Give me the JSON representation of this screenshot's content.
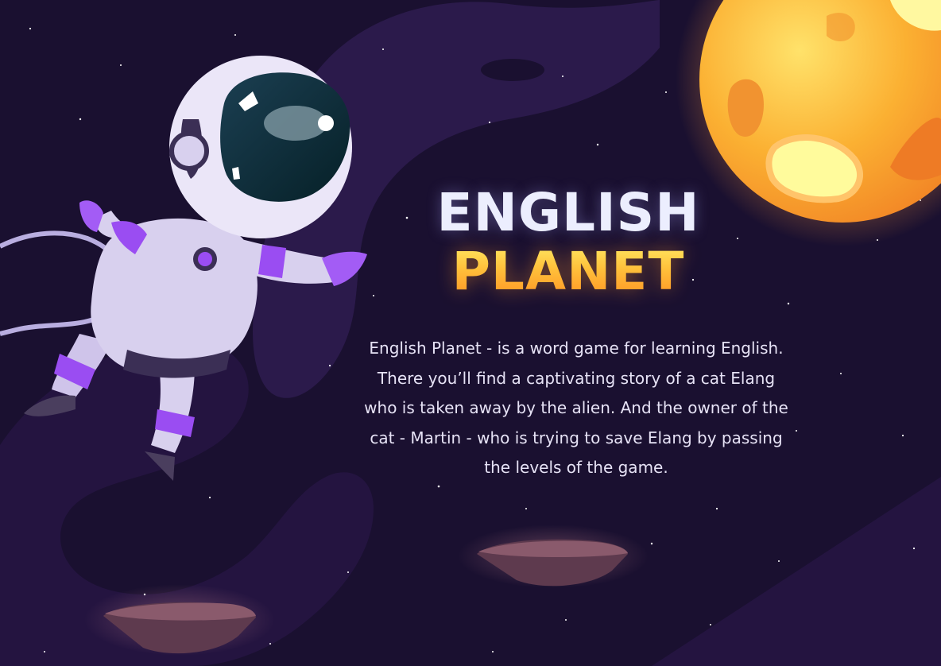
{
  "title": {
    "line1": "ENGLISH",
    "line2": "PLANET"
  },
  "description": "English Planet - is a word game for learning English. There you’ll find a captivating story of a cat Elang who is taken away by the alien. And the owner of the cat - Martin - who is trying to save Elang by passing the levels of the game.",
  "colors": {
    "background": "#1a1030",
    "title_line1": "#eceefe",
    "title_line2_top": "#fff06a",
    "title_line2_bottom": "#ff8a1f",
    "astronaut_suit": "#d8d0ee",
    "astronaut_accent": "#9a4df2",
    "planet": "#f9a62b",
    "rock": "#5e3a4e"
  },
  "icons": [
    "astronaut-illustration",
    "sun-planet-illustration",
    "floating-rock-illustration",
    "star-icon"
  ]
}
